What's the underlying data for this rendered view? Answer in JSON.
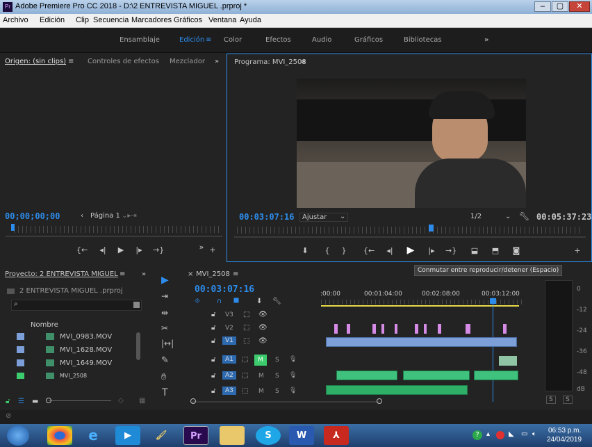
{
  "window": {
    "title": "Adobe Premiere Pro CC 2018 - D:\\2 ENTREVISTA MIGUEL .prproj *"
  },
  "menu": [
    "Archivo",
    "Edición",
    "Clip",
    "Secuencia",
    "Marcadores",
    "Gráficos",
    "Ventana",
    "Ayuda"
  ],
  "workspaces": [
    "Ensamblaje",
    "Edición",
    "Color",
    "Efectos",
    "Audio",
    "Gráficos",
    "Bibliotecas",
    "»"
  ],
  "source": {
    "tabs": [
      "Origen: (sin clips)",
      "Controles de efectos",
      "Mezclador"
    ],
    "timecode": "00;00;00;00",
    "page": "Página 1"
  },
  "program": {
    "title": "Programa: MVI_2508",
    "timecode": "00:03:07:16",
    "fit": "Ajustar",
    "res": "1/2",
    "duration": "00:05:37:23",
    "tooltip": "Conmutar entre reproducir/detener (Espacio)"
  },
  "project": {
    "title": "Proyecto: 2 ENTREVISTA MIGUEL",
    "file": "2 ENTREVISTA MIGUEL .prproj",
    "col": "Nombre",
    "items": [
      "MVI_0983.MOV",
      "MVI_1628.MOV",
      "MVI_1649.MOV",
      "MVI_2508"
    ]
  },
  "timeline": {
    "title": "MVI_2508",
    "timecode": "00:03:07:16",
    "ruler": [
      ":00:00",
      "00:01:04:00",
      "00:02:08:00",
      "00:03:12:00"
    ],
    "tracks": [
      {
        "name": "V3"
      },
      {
        "name": "V2"
      },
      {
        "name": "V1"
      },
      {
        "name": "A1",
        "m": "M",
        "s": "S"
      },
      {
        "name": "A2",
        "m": "M",
        "s": "S"
      },
      {
        "name": "A3",
        "m": "M",
        "s": "S"
      }
    ]
  },
  "meter": {
    "labels": [
      "0",
      "-12",
      "-24",
      "-36",
      "-48",
      "dB"
    ],
    "solo": [
      "S",
      "S"
    ]
  },
  "taskbar": {
    "time": "06:53 p.m.",
    "date": "24/04/2019"
  }
}
